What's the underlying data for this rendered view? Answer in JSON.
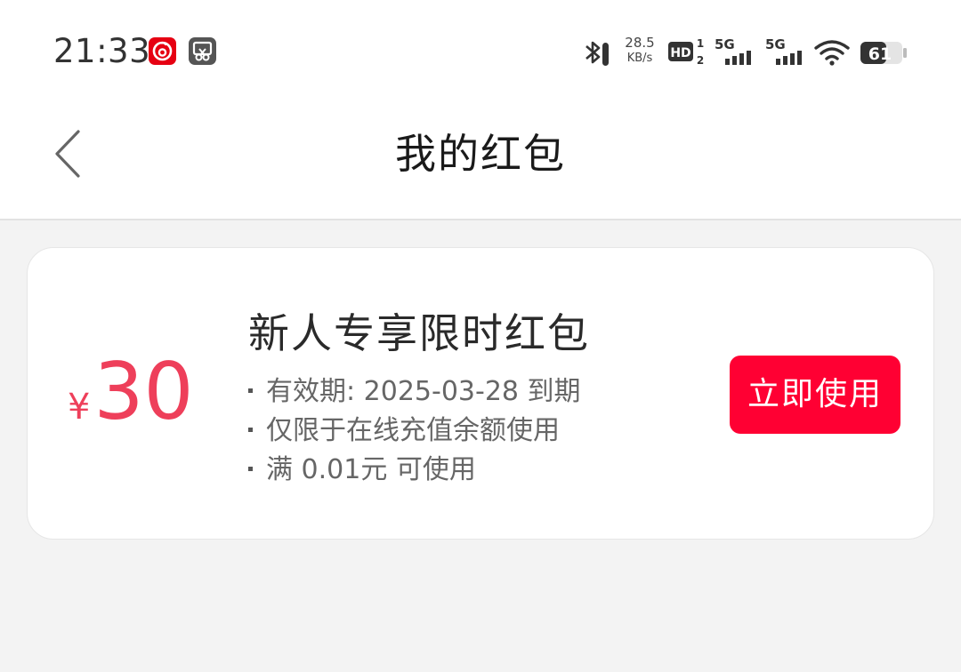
{
  "status_bar": {
    "time": "21:33",
    "net_speed_value": "28.5",
    "net_speed_unit": "KB/s",
    "hd_label": "HD",
    "sim1_sup": "1",
    "sim1_sub": "2",
    "sim1_network": "5G",
    "sim2_network": "5G",
    "battery_level": "61",
    "icons": [
      "netease-music-icon",
      "screenshot-cut-icon",
      "bluetooth-icon",
      "hd-voice-icon",
      "signal-5g-icon",
      "signal-5g-icon",
      "wifi-icon",
      "battery-icon"
    ]
  },
  "header": {
    "back_icon": "chevron-left-icon",
    "title": "我的红包"
  },
  "coupon": {
    "currency_symbol": "¥",
    "amount": "30",
    "title": "新人专享限时红包",
    "conditions": [
      "有效期: 2025-03-28 到期",
      "仅限于在线充值余额使用",
      "满 0.01元 可使用"
    ],
    "action_label": "立即使用",
    "colors": {
      "amount": "#ee3f5a",
      "button": "#ff0033"
    }
  }
}
